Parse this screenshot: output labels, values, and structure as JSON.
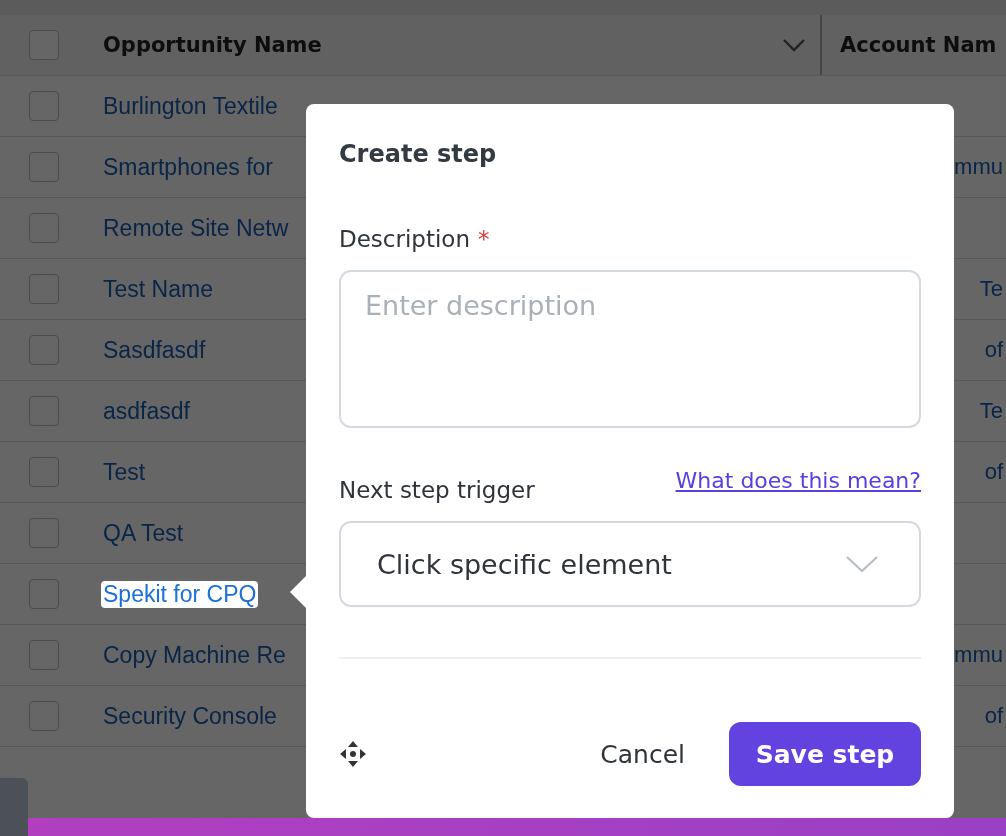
{
  "table": {
    "header_checkbox": {
      "checked": false
    },
    "columns": [
      {
        "label": "Opportunity Name"
      },
      {
        "label": "Account Nam"
      }
    ],
    "rows": [
      {
        "name": "Burlington Textile",
        "account": "",
        "checked": false,
        "highlighted": false
      },
      {
        "name": "Smartphones for",
        "account": "mmu",
        "checked": false,
        "highlighted": false
      },
      {
        "name": "Remote Site Netw",
        "account": "",
        "checked": false,
        "highlighted": false
      },
      {
        "name": "Test Name",
        "account": "Te",
        "checked": false,
        "highlighted": false
      },
      {
        "name": "Sasdfasdf",
        "account": "of",
        "checked": false,
        "highlighted": false
      },
      {
        "name": "asdfasdf",
        "account": "Te",
        "checked": false,
        "highlighted": false
      },
      {
        "name": "Test",
        "account": "of",
        "checked": false,
        "highlighted": false
      },
      {
        "name": "QA Test",
        "account": "",
        "checked": false,
        "highlighted": false
      },
      {
        "name": "Spekit for CPQ",
        "account": "",
        "checked": false,
        "highlighted": true
      },
      {
        "name": "Copy Machine Re",
        "account": "mmu",
        "checked": false,
        "highlighted": false
      },
      {
        "name": "Security Console",
        "account": "of",
        "checked": false,
        "highlighted": false
      }
    ]
  },
  "dialog": {
    "title": "Create step",
    "description": {
      "label": "Description",
      "required_mark": "*",
      "placeholder": "Enter description"
    },
    "trigger": {
      "label": "Next step trigger",
      "help_link": "What does this mean?",
      "value": "Click specific element"
    },
    "buttons": {
      "cancel": "Cancel",
      "save": "Save step"
    }
  }
}
